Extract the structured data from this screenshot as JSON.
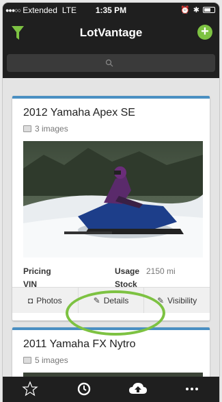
{
  "status_bar": {
    "carrier": "Extended",
    "network": "LTE",
    "time": "1:35 PM"
  },
  "nav": {
    "title": "LotVantage",
    "add_label": "+"
  },
  "search": {
    "placeholder": ""
  },
  "cards": [
    {
      "title": "2012 Yamaha Apex SE",
      "image_count": "3 images",
      "pricing_label": "Pricing",
      "vin_label": "VIN",
      "usage_label": "Usage",
      "usage_value": "2150 mi",
      "stock_label": "Stock",
      "actions": {
        "photos": "Photos",
        "details": "Details",
        "visibility": "Visibility"
      }
    },
    {
      "title": "2011 Yamaha FX Nytro",
      "image_count": "5 images"
    }
  ],
  "tab_bar": {
    "items": [
      {
        "icon": "star-icon"
      },
      {
        "icon": "refresh-icon"
      },
      {
        "icon": "cloud-upload-icon"
      },
      {
        "icon": "more-icon"
      }
    ]
  },
  "colors": {
    "accent": "#7dc242",
    "card_border": "#4a8fc2",
    "bar": "#1f1f1f"
  }
}
